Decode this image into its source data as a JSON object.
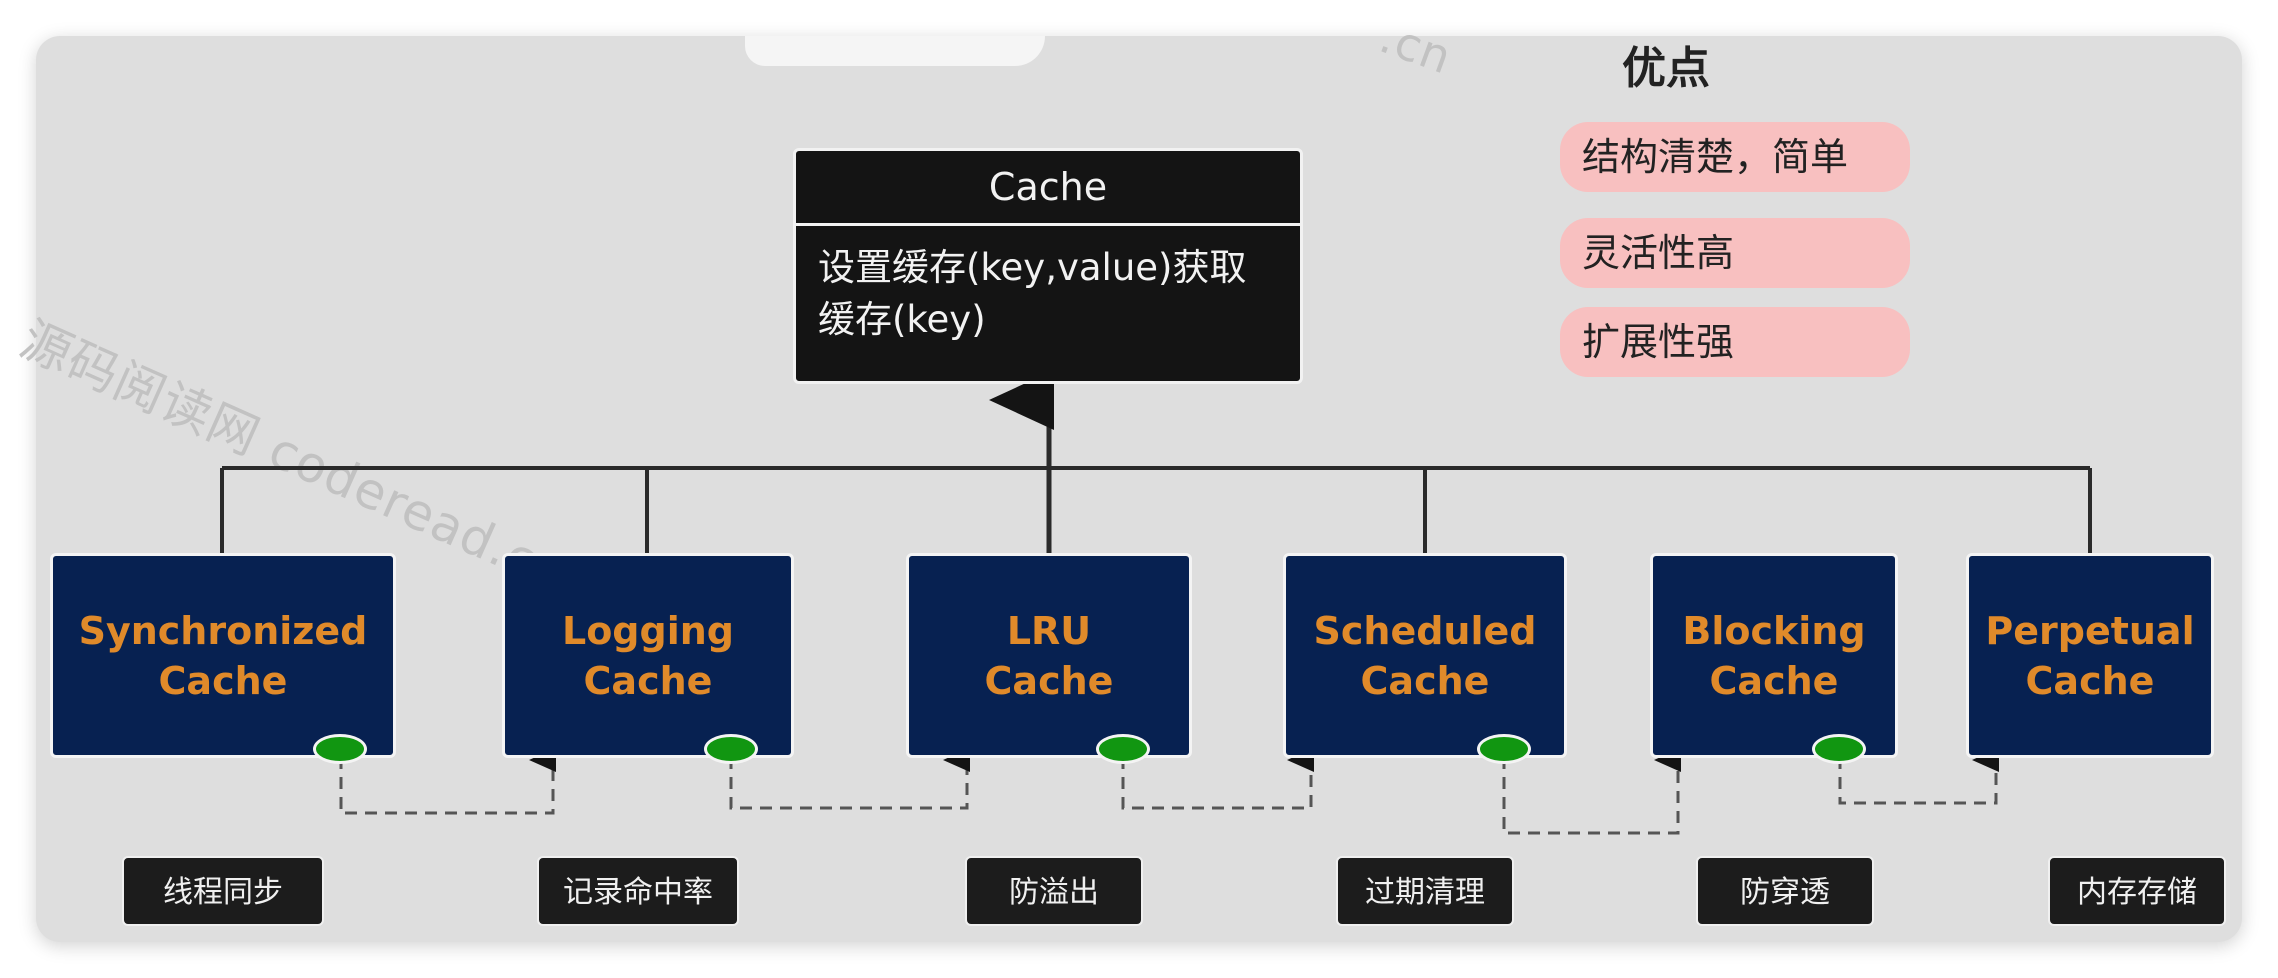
{
  "watermark": {
    "main": "源码阅读网 coderead.cn",
    "top": ".cn"
  },
  "cache": {
    "title": "Cache",
    "body_line1": "设置缓存(key,value)获取",
    "body_line2": "缓存(key)"
  },
  "advantages": {
    "title": "优点",
    "items": [
      "结构清楚，简单",
      "灵活性高",
      "扩展性强"
    ]
  },
  "implementations": [
    {
      "line1": "Synchronized",
      "line2": "Cache",
      "feature": "线程同步"
    },
    {
      "line1": "Logging",
      "line2": "Cache",
      "feature": "记录命中率"
    },
    {
      "line1": "LRU",
      "line2": "Cache",
      "feature": "防溢出"
    },
    {
      "line1": "Scheduled",
      "line2": "Cache",
      "feature": "过期清理"
    },
    {
      "line1": "Blocking",
      "line2": "Cache",
      "feature": "防穿透"
    },
    {
      "line1": "Perpetual",
      "line2": "Cache",
      "feature": "内存存储"
    }
  ],
  "colors": {
    "impl_fill": "#072151",
    "impl_text": "#e08a2a",
    "connector_dot": "#119611",
    "advantage_fill": "#f8c0c0",
    "interface_fill": "#141414"
  }
}
